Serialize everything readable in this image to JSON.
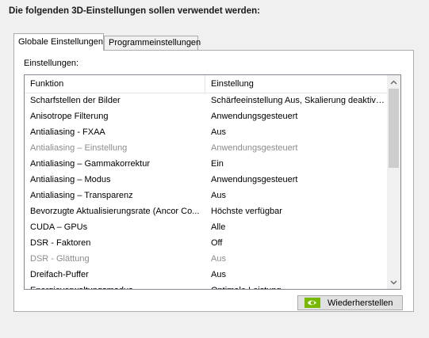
{
  "heading": "Die folgenden 3D-Einstellungen sollen verwendet werden:",
  "tabs": [
    "Globale Einstellungen",
    "Programmeinstellungen"
  ],
  "settings_label": "Einstellungen:",
  "columns": {
    "function": "Funktion",
    "setting": "Einstellung"
  },
  "rows": [
    {
      "function": "Scharfstellen der Bilder",
      "setting": "Schärfeeinstellung Aus, Skalierung deaktiv…",
      "disabled": false
    },
    {
      "function": "Anisotrope Filterung",
      "setting": "Anwendungsgesteuert",
      "disabled": false
    },
    {
      "function": "Antialiasing - FXAA",
      "setting": "Aus",
      "disabled": false
    },
    {
      "function": "Antialiasing – Einstellung",
      "setting": "Anwendungsgesteuert",
      "disabled": true
    },
    {
      "function": "Antialiasing – Gammakorrektur",
      "setting": "Ein",
      "disabled": false
    },
    {
      "function": "Antialiasing – Modus",
      "setting": "Anwendungsgesteuert",
      "disabled": false
    },
    {
      "function": "Antialiasing – Transparenz",
      "setting": "Aus",
      "disabled": false
    },
    {
      "function": "Bevorzugte Aktualisierungsrate (Ancor Co...",
      "setting": "Höchste verfügbar",
      "disabled": false
    },
    {
      "function": "CUDA – GPUs",
      "setting": "Alle",
      "disabled": false
    },
    {
      "function": "DSR - Faktoren",
      "setting": "Off",
      "disabled": false
    },
    {
      "function": "DSR - Glättung",
      "setting": "Aus",
      "disabled": true
    },
    {
      "function": "Dreifach-Puffer",
      "setting": "Aus",
      "disabled": false
    },
    {
      "function": "Energieverwaltungsmodus",
      "setting": "Optimale Leistung",
      "disabled": false
    }
  ],
  "restore_button": "Wiederherstellen",
  "icons": {
    "restore": "nvidia-logo-icon",
    "scroll_up": "chevron-up-icon",
    "scroll_down": "chevron-down-icon"
  },
  "colors": {
    "disabled_text": "#8c8c8c",
    "nvidia_green": "#76b900"
  }
}
